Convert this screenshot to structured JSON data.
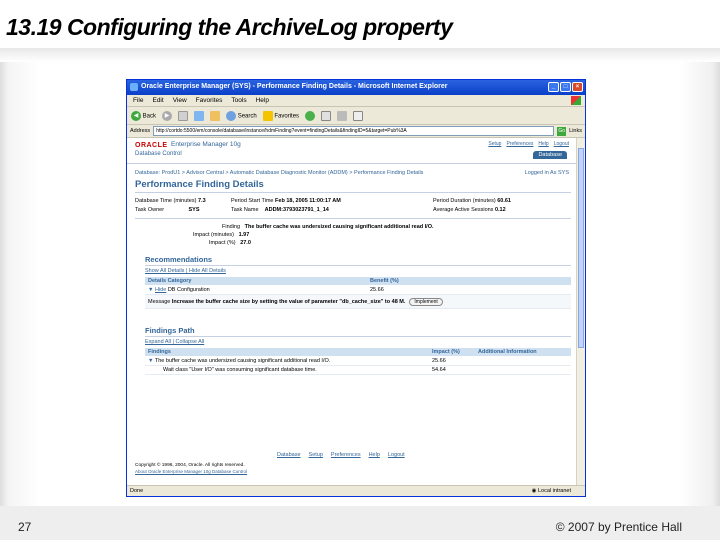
{
  "slide": {
    "title": "13.19 Configuring the ArchiveLog property",
    "page_number": "27",
    "copyright": "© 2007 by Prentice Hall"
  },
  "browser": {
    "title": "Oracle Enterprise Manager (SYS) - Performance Finding Details - Microsoft Internet Explorer",
    "menu": [
      "File",
      "Edit",
      "View",
      "Favorites",
      "Tools",
      "Help"
    ],
    "toolbar": {
      "back": "Back",
      "search": "Search",
      "favorites": "Favorites"
    },
    "address_label": "Address",
    "address_value": "http://cortdo:5500/em/console/database/instance/hdmFinding?event=findingDetails&findingID=5&target=Pub%3A",
    "go_label": "Go",
    "links_label": "Links",
    "status_text": "Done",
    "status_zone": "Local intranet"
  },
  "oem": {
    "logo": "ORACLE",
    "product": "Enterprise Manager 10g",
    "subproduct": "Database Control",
    "global_links": [
      "Setup",
      "Preferences",
      "Help",
      "Logout"
    ],
    "db_tab": "Database",
    "breadcrumb": "Database: ProdU1 > Advisor Central > Automatic Database Diagnostic Monitor (ADDM) > Performance Finding Details",
    "logged_in": "Logged in As SYS",
    "page_title": "Performance Finding Details",
    "details": {
      "db_time_label": "Database Time (minutes)",
      "db_time_value": "7.3",
      "period_start_label": "Period Start Time",
      "period_start_value": "Feb 18, 2005 11:00:17 AM",
      "period_duration_label": "Period Duration (minutes)",
      "period_duration_value": "60.61",
      "task_owner_label": "Task Owner",
      "task_owner_value": "SYS",
      "task_name_label": "Task Name",
      "task_name_value": "ADDM:3793023791_1_14",
      "avg_sessions_label": "Average Active Sessions",
      "avg_sessions_value": "0.12",
      "finding_label": "Finding",
      "finding_value": "The buffer cache was undersized causing significant additional read I/O.",
      "impact_min_label": "Impact (minutes)",
      "impact_min_value": "1.97",
      "impact_pct_label": "Impact (%)",
      "impact_pct_value": "27.0"
    },
    "recommendations": {
      "heading": "Recommendations",
      "show_all": "Show All Details",
      "hide_all": "Hide All Details",
      "col_category": "Details Category",
      "col_benefit": "Benefit (%)",
      "row_toggle": "Hide",
      "row_category": "DB Configuration",
      "row_benefit": "25.66",
      "message_label": "Message",
      "message_text": "Increase the buffer cache size by setting the value of parameter \"db_cache_size\" to 48 M.",
      "implement_label": "Implement"
    },
    "findings_path": {
      "heading": "Findings Path",
      "expand_all": "Expand All",
      "collapse_all": "Collapse All",
      "col_findings": "Findings",
      "col_impact": "Impact (%)",
      "col_additional": "Additional Information",
      "rows": [
        {
          "finding": "The buffer cache was undersized causing significant additional read I/O.",
          "impact": "25.66"
        },
        {
          "finding": "Wait class \"User I/O\" was consuming significant database time.",
          "impact": "54.64"
        }
      ]
    },
    "footer_links": [
      "Database",
      "Setup",
      "Preferences",
      "Help",
      "Logout"
    ],
    "copyright": "Copyright © 1996, 2004, Oracle. All rights reserved.",
    "about_link": "About Oracle Enterprise Manager 10g Database Control"
  },
  "colors": {
    "oracle_red": "#cc0000",
    "oem_blue": "#336699",
    "xp_blue": "#0a3fc8"
  }
}
